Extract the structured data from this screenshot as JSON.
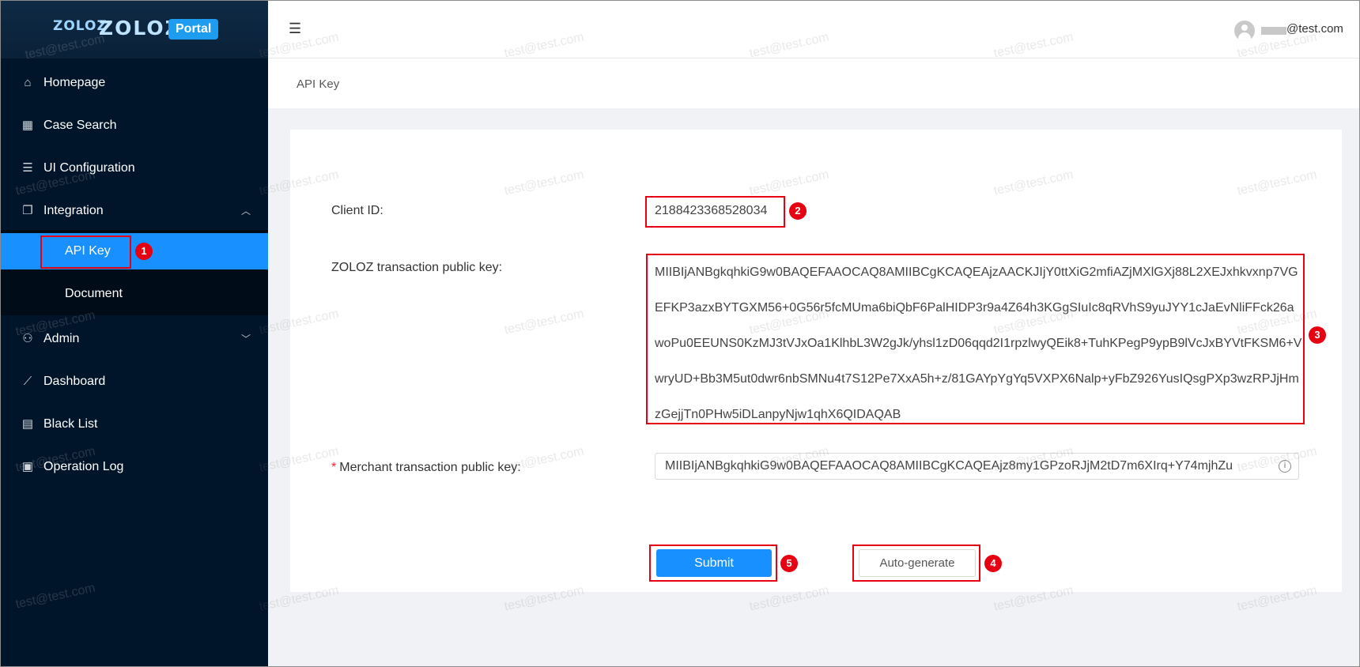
{
  "brand": {
    "logo_mark": "ZOLOZ",
    "logo_text": "ZOLOZ",
    "badge": "Portal"
  },
  "sidebar": {
    "items": [
      {
        "label": "Homepage",
        "icon": "home-icon"
      },
      {
        "label": "Case Search",
        "icon": "table-icon"
      },
      {
        "label": "UI Configuration",
        "icon": "list-icon"
      },
      {
        "label": "Integration",
        "icon": "document-icon",
        "expanded": true
      },
      {
        "label": "Admin",
        "icon": "users-icon",
        "expanded": false
      },
      {
        "label": "Dashboard",
        "icon": "chart-icon"
      },
      {
        "label": "Black List",
        "icon": "blacklist-icon"
      },
      {
        "label": "Operation Log",
        "icon": "log-icon"
      }
    ],
    "submenu": [
      {
        "label": "API Key",
        "selected": true
      },
      {
        "label": "Document",
        "selected": false
      }
    ]
  },
  "header": {
    "user_domain": "@test.com"
  },
  "breadcrumb": "API Key",
  "form": {
    "client_id_label": "Client ID:",
    "client_id": "2188423368528034",
    "zoloz_key_label": "ZOLOZ transaction public key:",
    "zoloz_key": "MIIBIjANBgkqhkiG9w0BAQEFAAOCAQ8AMIIBCgKCAQEAjzAACKJIjY0ttXiG2mfiAZjMXlGXj88L2XEJxhkvxnp7VGEFKP3azxBYTGXM56+0G56r5fcMUma6biQbF6PalHIDP3r9a4Z64h3KGgSIuIc8qRVhS9yuJYY1cJaEvNliFFck26awoPu0EEUNS0KzMJ3tVJxOa1KlhbL3W2gJk/yhsl1zD06qqd2I1rpzlwyQEik8+TuhKPegP9ypB9lVcJxBYVtFKSM6+VwryUD+Bb3M5ut0dwr6nbSMNu4t7S12Pe7XxA5h+z/81GAYpYgYq5VXPX6Nalp+yFbZ926YusIQsgPXp3wzRPJjHmzGejjTn0PHw5iDLanpyNjw1qhX6QIDAQAB",
    "merchant_key_label": "Merchant transaction public key:",
    "merchant_key_required_mark": "*",
    "merchant_key_value": "MIIBIjANBgkqhkiG9w0BAQEFAAOCAQ8AMIIBCgKCAQEAjz8my1GPzoRJjM2tD7m6XIrq+Y74mjhZu",
    "submit_label": "Submit",
    "autogen_label": "Auto-generate"
  },
  "annotations": [
    "1",
    "2",
    "3",
    "4",
    "5"
  ],
  "watermark": "test@test.com",
  "colors": {
    "sidebar_bg": "#001529",
    "selected": "#1890ff",
    "annotation": "#e60012",
    "badge": "#1e9cf0"
  }
}
